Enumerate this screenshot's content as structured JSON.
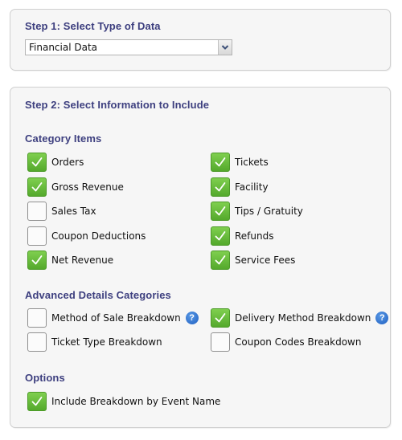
{
  "step1": {
    "title": "Step 1: Select Type of Data",
    "data_type_select": {
      "value": "Financial Data"
    }
  },
  "step2": {
    "title": "Step 2: Select Information to Include",
    "category_items": {
      "title": "Category Items",
      "left": [
        {
          "label": "Orders",
          "checked": true
        },
        {
          "label": "Gross Revenue",
          "checked": true
        },
        {
          "label": "Sales Tax",
          "checked": false
        },
        {
          "label": "Coupon Deductions",
          "checked": false
        },
        {
          "label": "Net Revenue",
          "checked": true
        }
      ],
      "right": [
        {
          "label": "Tickets",
          "checked": true
        },
        {
          "label": "Facility",
          "checked": true
        },
        {
          "label": "Tips / Gratuity",
          "checked": true
        },
        {
          "label": "Refunds",
          "checked": true
        },
        {
          "label": "Service Fees",
          "checked": true
        }
      ]
    },
    "advanced": {
      "title": "Advanced Details Categories",
      "items": [
        {
          "label": "Method of Sale Breakdown",
          "checked": false,
          "help": true
        },
        {
          "label": "Delivery Method Breakdown",
          "checked": true,
          "help": true
        },
        {
          "label": "Ticket Type Breakdown",
          "checked": false,
          "help": false
        },
        {
          "label": "Coupon Codes Breakdown",
          "checked": false,
          "help": false
        }
      ]
    },
    "options": {
      "title": "Options",
      "items": [
        {
          "label": "Include Breakdown by Event Name",
          "checked": true
        }
      ]
    }
  },
  "icons": {
    "check": "checkmark-icon",
    "help": "help-question-icon",
    "help_glyph": "?",
    "dropdown": "chevron-down-icon"
  },
  "colors": {
    "heading": "#3d3f7f",
    "check_green": "#5cb234",
    "help_blue": "#2f6fd0"
  }
}
